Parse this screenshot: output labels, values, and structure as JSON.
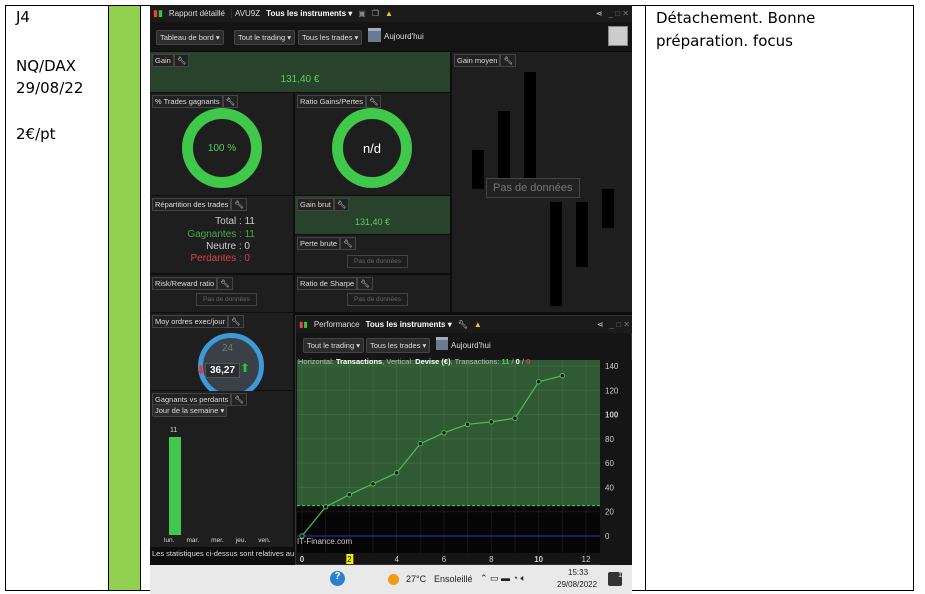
{
  "left_cell": {
    "day": "J4",
    "instruments": "NQ/DAX",
    "date": "29/08/22",
    "risk": "2€/pt"
  },
  "right_cell": {
    "note": "Détachement. Bonne préparation. focus"
  },
  "colors": {
    "accent_green": "#3fc84a",
    "green_column": "#92d050",
    "loss_red": "#e04040",
    "panel_green": "#29422b"
  },
  "app": {
    "title": "Rapport détaillé",
    "account": "AVU9Z",
    "instrument": "Tous les instruments",
    "toolbar": {
      "dashboard": "Tableau de bord",
      "trading": "Tout le trading",
      "trades": "Tous les trades",
      "date": "Aujourd'hui"
    },
    "gain": {
      "label": "Gain",
      "value": "131,40 €"
    },
    "gain_moyen": {
      "label": "Gain moyen",
      "nodata": "Pas de données"
    },
    "pct_winning": {
      "label": "% Trades gagnants",
      "value": "100 %",
      "fraction": 1.0
    },
    "ratio_gains": {
      "label": "Ratio Gains/Pertes",
      "value": "n/d"
    },
    "repartition": {
      "label": "Répartition des trades",
      "total": "Total : 11",
      "winners": "Gagnantes : 11",
      "neutral": "Neutre : 0",
      "losers": "Perdantes : 0"
    },
    "gain_brut": {
      "label": "Gain brut",
      "value": "131,40 €"
    },
    "perte_brute": {
      "label": "Perte brute",
      "nodata": "Pas de données"
    },
    "risk_reward": {
      "label": "Risk/Reward ratio",
      "nodata": "Pas de données"
    },
    "sharpe": {
      "label": "Ratio de Sharpe",
      "nodata": "Pas de données"
    },
    "orders": {
      "label": "Moy ordres exec/jour",
      "clock": "24",
      "value": "36,27"
    },
    "winners_losers": {
      "label": "Gagnants vs perdants",
      "select": "Jour de la semaine",
      "bar_value": "11",
      "days": [
        "lun.",
        "mar.",
        "mer.",
        "jeu.",
        "ven."
      ],
      "values": [
        11,
        0,
        0,
        0,
        0
      ]
    },
    "footer": "Les statistiques ci-dessus sont relatives au p",
    "performance": {
      "title": "Performance",
      "instrument": "Tous les instruments",
      "trading": "Tout le trading",
      "trades": "Tous les trades",
      "date": "Aujourd'hui",
      "legend_prefix": "Horizontal: ",
      "legend_h": "Transactions",
      "legend_mid": ", Vertical: ",
      "legend_v": "Devise (€)",
      "legend_tx": ", Transactions: ",
      "tx_win": "11",
      "tx_sep1": " / ",
      "tx_neutral": "0",
      "tx_sep2": " / ",
      "tx_loss": "0",
      "watermark": "IT-Finance.com"
    }
  },
  "chart_data": {
    "type": "line",
    "x": [
      0,
      1,
      2,
      3,
      4,
      5,
      6,
      7,
      8,
      9,
      10,
      11
    ],
    "y": [
      0,
      24,
      34,
      43,
      52,
      76,
      85,
      92,
      94,
      97,
      127,
      132
    ],
    "xlabel": "Transactions",
    "ylabel": "Devise (€)",
    "xlim": [
      0,
      12
    ],
    "ylim": [
      -5,
      145
    ],
    "xticks": [
      "0",
      "2",
      "4",
      "6",
      "8",
      "10",
      "12"
    ],
    "yticks": [
      "0",
      "20",
      "40",
      "60",
      "80",
      "100",
      "120",
      "140"
    ],
    "threshold": 25,
    "grid": true
  },
  "taskbar": {
    "weather": "27°C",
    "condition": "Ensoleillé",
    "time": "15:33",
    "date": "29/08/2022",
    "notifications": "1"
  }
}
